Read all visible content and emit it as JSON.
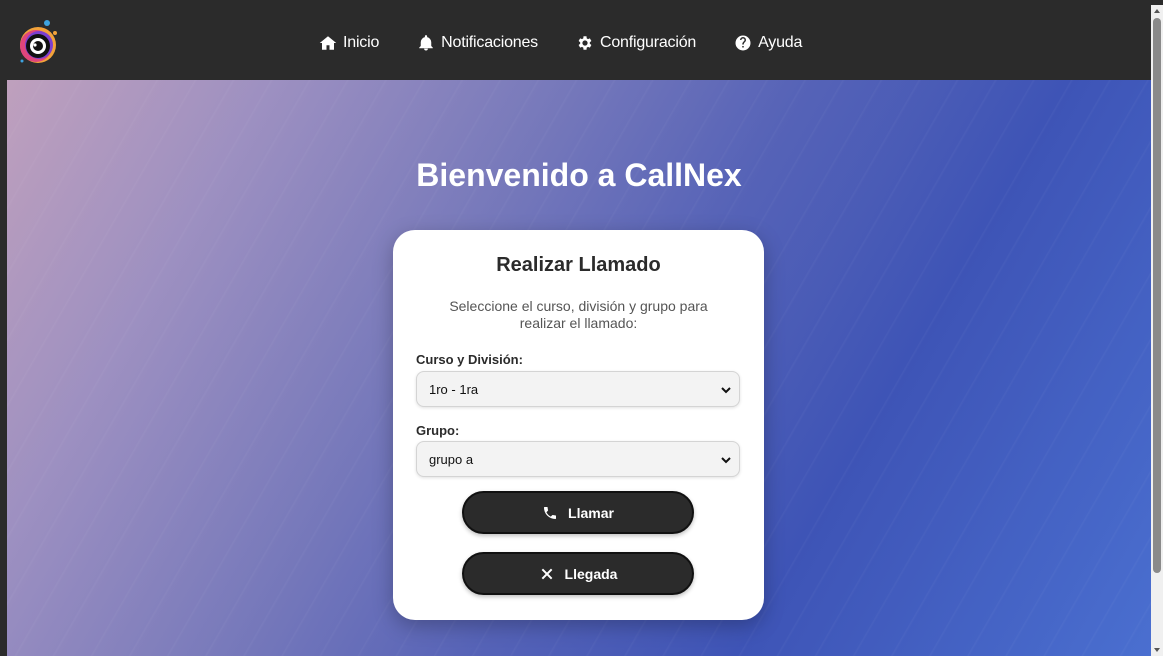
{
  "nav": {
    "items": [
      {
        "label": "Inicio",
        "icon": "home-icon"
      },
      {
        "label": "Notificaciones",
        "icon": "bell-icon"
      },
      {
        "label": "Configuración",
        "icon": "gear-icon"
      },
      {
        "label": "Ayuda",
        "icon": "help-circle-icon"
      }
    ]
  },
  "hero": {
    "title": "Bienvenido a CallNex"
  },
  "card": {
    "title": "Realizar Llamado",
    "description": "Seleccione el curso, división y grupo para realizar el llamado:",
    "course_label": "Curso y División:",
    "course_value": "1ro - 1ra",
    "group_label": "Grupo:",
    "group_value": "grupo a",
    "call_button": "Llamar",
    "arrival_button": "Llegada"
  },
  "colors": {
    "navbar": "#2b2b2b",
    "button": "#2b2b2b",
    "gradient_start": "#bfa0bd",
    "gradient_end": "#4a6fd0"
  }
}
